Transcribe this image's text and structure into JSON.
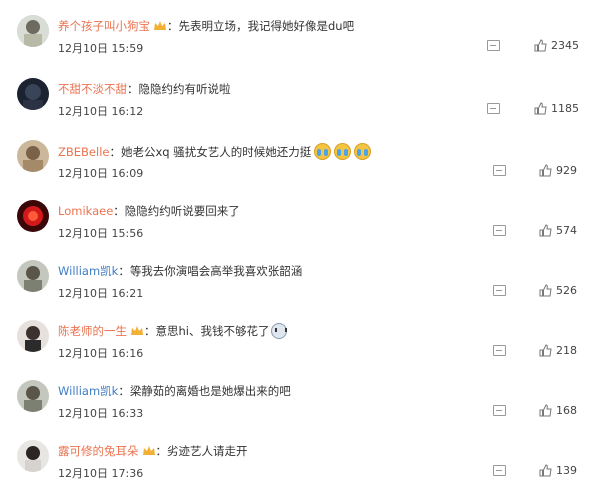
{
  "comments": [
    {
      "user": "养个孩子叫小狗宝",
      "sep": "：",
      "text": "先表明立场，我记得她好像是du吧",
      "time": "12月10日 15:59",
      "likes": "2345",
      "crown": true
    },
    {
      "user": "不甜不淡不甜",
      "sep": "：",
      "text": "隐隐约约有听说啦",
      "time": "12月10日 16:12",
      "likes": "1185",
      "crown": false
    },
    {
      "user": "ZBEBelle",
      "sep": "：",
      "text": "她老公xq 骚扰女艺人的时候她还力挺",
      "time": "12月10日 16:09",
      "likes": "929",
      "crown": false
    },
    {
      "user": "Lomikaee",
      "sep": "：",
      "text": "隐隐约约听说要回来了",
      "time": "12月10日 15:56",
      "likes": "574",
      "crown": false
    },
    {
      "user": "William凯k",
      "sep": "：",
      "text": "等我去你演唱会高举我喜欢张韶涵",
      "time": "12月10日 16:21",
      "likes": "526",
      "crown": false
    },
    {
      "user": "陈老师的一生",
      "sep": "：",
      "text": "意思hi、我钱不够花了",
      "time": "12月10日 16:16",
      "likes": "218",
      "crown": true
    },
    {
      "user": "William凯k",
      "sep": "：",
      "text": "梁静茹的离婚也是她爆出来的吧",
      "time": "12月10日 16:33",
      "likes": "168",
      "crown": false
    },
    {
      "user": "露可修的兔耳朵",
      "sep": "：",
      "text": "劣迹艺人请走开",
      "time": "12月10日 17:36",
      "likes": "139",
      "crown": true
    }
  ]
}
